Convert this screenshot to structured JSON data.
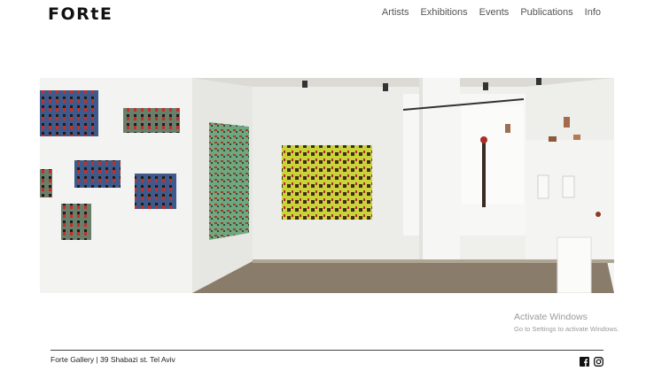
{
  "header": {
    "logo": "FORtE",
    "nav": [
      "Artists",
      "Exhibitions",
      "Events",
      "Publications",
      "Info"
    ]
  },
  "hero": {
    "icon": "gallery-photo"
  },
  "watermark": {
    "title": "Activate Windows",
    "subtitle": "Go to Settings to activate Windows."
  },
  "footer": {
    "address": "Forte Gallery | 39 Shabazi st. Tel Aviv",
    "social_icons": [
      "facebook-icon",
      "instagram-icon"
    ]
  }
}
